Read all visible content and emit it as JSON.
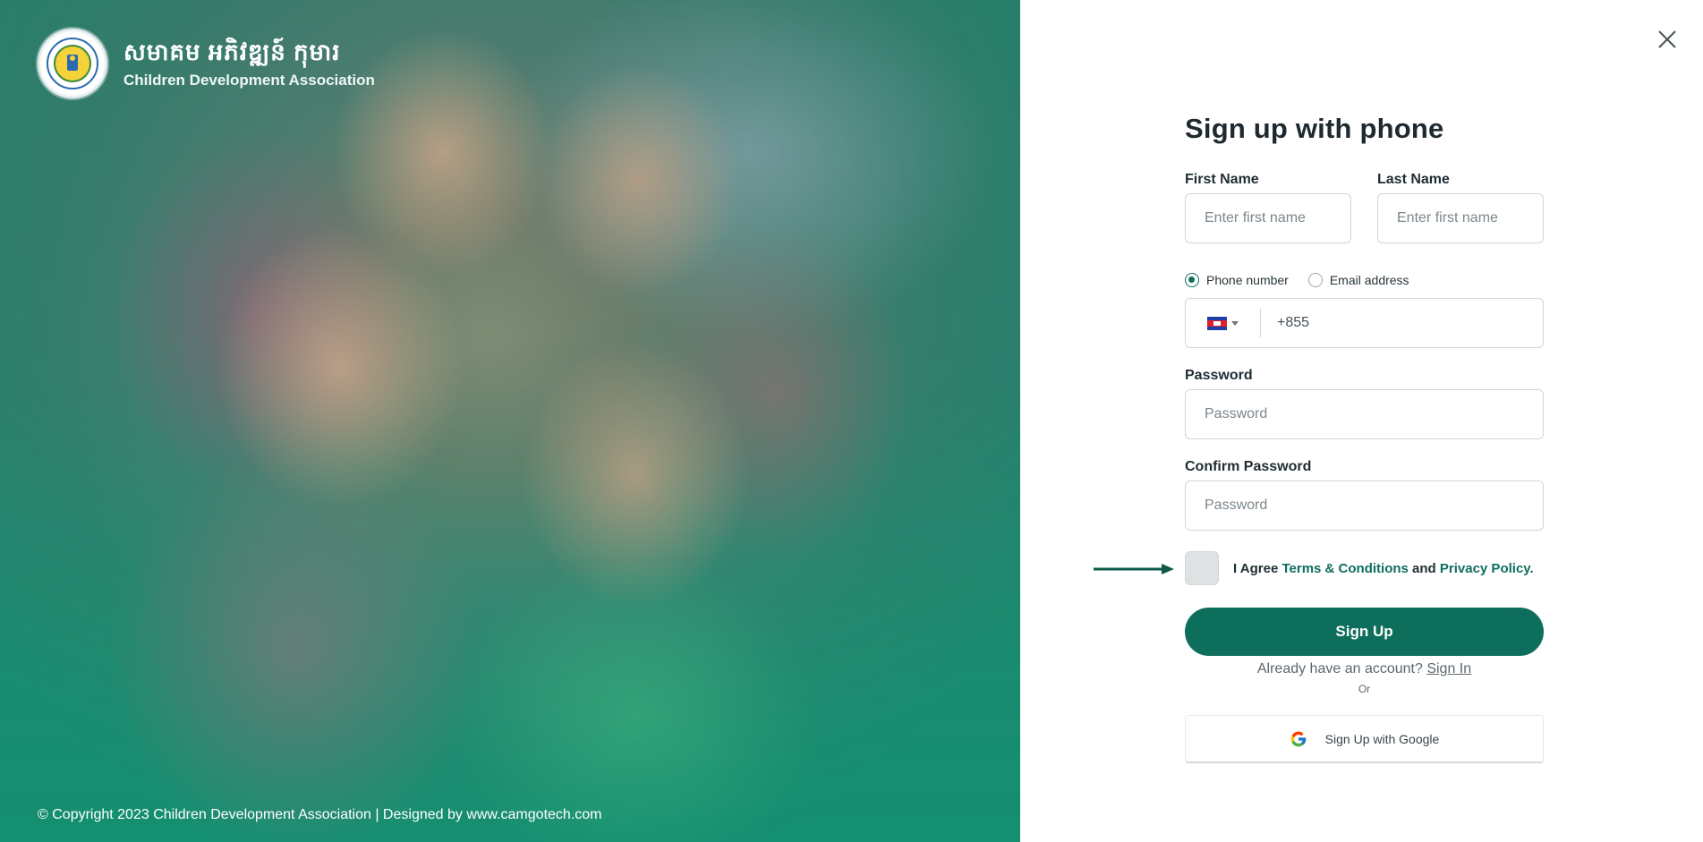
{
  "brand": {
    "khmer_name": "សមាគម អភិវឌ្ឍន៍ កុមារ",
    "english_name": "Children Development Association"
  },
  "footer": {
    "copyright": "© Copyright 2023 Children Development Association | Designed by www.camgotech.com"
  },
  "form": {
    "title": "Sign up with phone",
    "first_name": {
      "label": "First Name",
      "placeholder": "Enter first name"
    },
    "last_name": {
      "label": "Last Name",
      "placeholder": "Enter first name"
    },
    "contact_options": [
      {
        "label": "Phone number",
        "selected": true
      },
      {
        "label": "Email address",
        "selected": false
      }
    ],
    "phone": {
      "country_code": "+855",
      "country": "Cambodia"
    },
    "password": {
      "label": "Password",
      "placeholder": "Password"
    },
    "confirm_password": {
      "label": "Confirm Password",
      "placeholder": "Password"
    },
    "agree": {
      "prefix": "I Agree",
      "terms": "Terms & Conditions",
      "and": "and",
      "privacy": "Privacy Policy."
    },
    "submit_label": "Sign Up",
    "account_prompt": "Already have an account?",
    "signin_label": "Sign In",
    "or_label": "Or",
    "google_label": "Sign Up with Google"
  },
  "colors": {
    "primary": "#0d6e5b",
    "hero_overlay": "#0a876e"
  },
  "icons": [
    "close-icon",
    "flag-icon",
    "chevron-down-icon",
    "google-icon",
    "arrow-right-icon"
  ]
}
